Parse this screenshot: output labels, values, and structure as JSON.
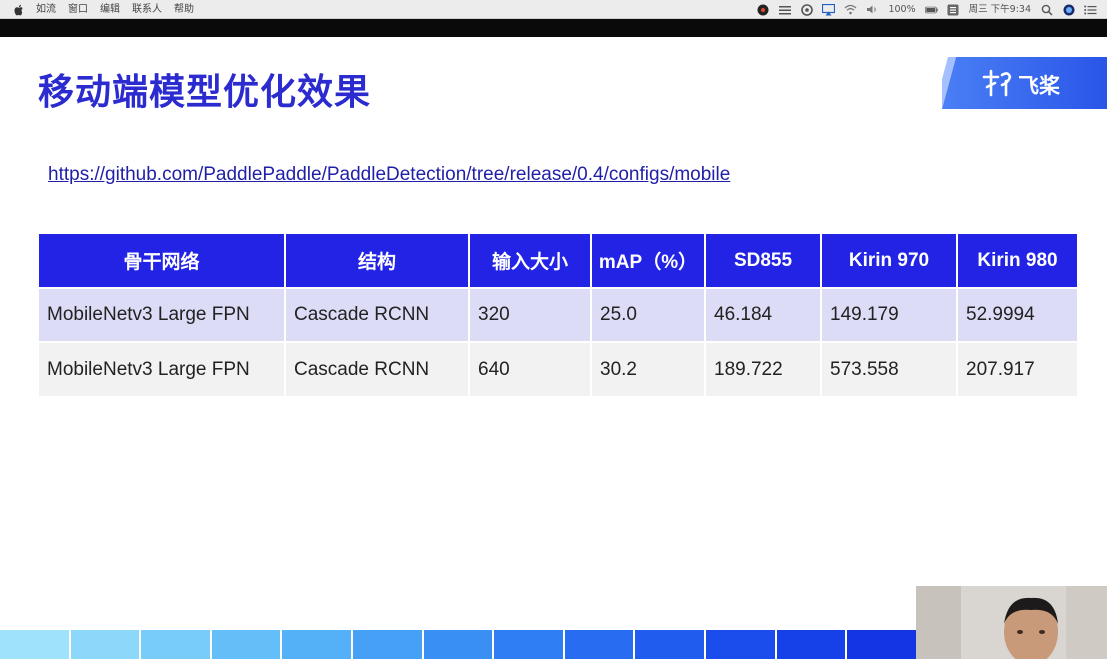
{
  "menubar": {
    "items": [
      "如流",
      "窗口",
      "编辑",
      "联系人",
      "帮助"
    ],
    "battery": "100%",
    "clock": "周三 下午9:34"
  },
  "slide": {
    "title": "移动端模型优化效果",
    "link": "https://github.com/PaddlePaddle/PaddleDetection/tree/release/0.4/configs/mobile",
    "logo_text": "飞桨",
    "accent_color": "#2b2bd0",
    "header_color": "#2323e6"
  },
  "table": {
    "headers": [
      "骨干网络",
      "结构",
      "输入大小",
      "mAP（%）",
      "SD855",
      "Kirin 970",
      "Kirin 980"
    ],
    "rows": [
      [
        "MobileNetv3 Large FPN",
        "Cascade RCNN",
        "320",
        "25.0",
        "46.184",
        "149.179",
        "52.9994"
      ],
      [
        "MobileNetv3 Large FPN",
        "Cascade RCNN",
        "640",
        "30.2",
        "189.722",
        "573.558",
        "207.917"
      ]
    ]
  }
}
